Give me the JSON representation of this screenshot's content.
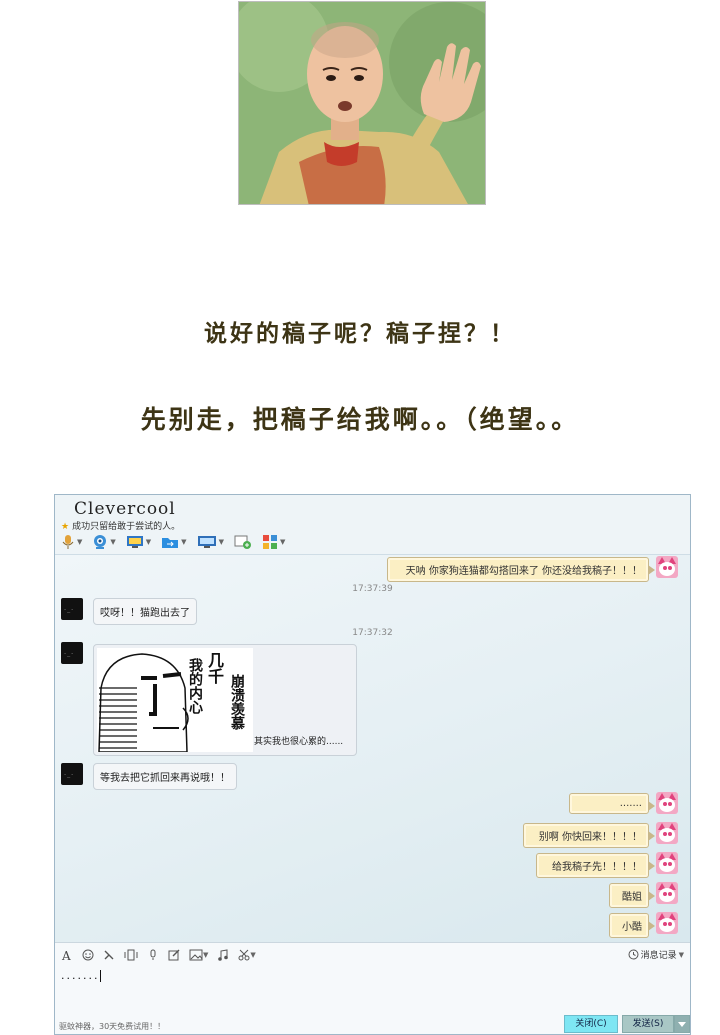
{
  "captions": {
    "line1": "说好的稿子呢？稿子捏？！",
    "line2": "先别走，把稿子给我啊。。（绝望。。"
  },
  "chat_window": {
    "contact_name": "Clevercool",
    "signature": "成功只留给敢于尝试的人。",
    "toolbar_icons": [
      "microphone-icon",
      "video-icon",
      "screen-share-icon",
      "file-transfer-icon",
      "remote-desktop-icon",
      "add-contact-icon",
      "apps-icon"
    ],
    "messages": [
      {
        "side": "out",
        "text": "天呐 你家狗连猫都勾搭回来了 你还没给我稿子！！！"
      },
      {
        "timestamp": "17:37:39"
      },
      {
        "side": "in",
        "text": "哎呀！！猫跑出去了"
      },
      {
        "timestamp": "17:37:32"
      },
      {
        "side": "in",
        "meme_text": [
          "几千",
          "我的内心",
          "崩溃",
          "羡慕"
        ],
        "text": "其实我也很心累的......"
      },
      {
        "side": "in",
        "text": "等我去把它抓回来再说哦！！"
      },
      {
        "side": "out",
        "text": "......."
      },
      {
        "side": "out",
        "text": "别啊 你快回来！！！！"
      },
      {
        "side": "out",
        "text": "给我稿子先！！！！"
      },
      {
        "side": "out",
        "text": "酷姐"
      },
      {
        "side": "out",
        "text": "小酷"
      }
    ],
    "input_text": ".......",
    "history_label": "消息记录",
    "footer_note": "驱蚊神器，30天免费试用！！",
    "close_button": "关闭(C)",
    "send_button": "发送(S)",
    "accent_color": "#7ee6f3",
    "bubble_out_color": "#fbefc4"
  }
}
